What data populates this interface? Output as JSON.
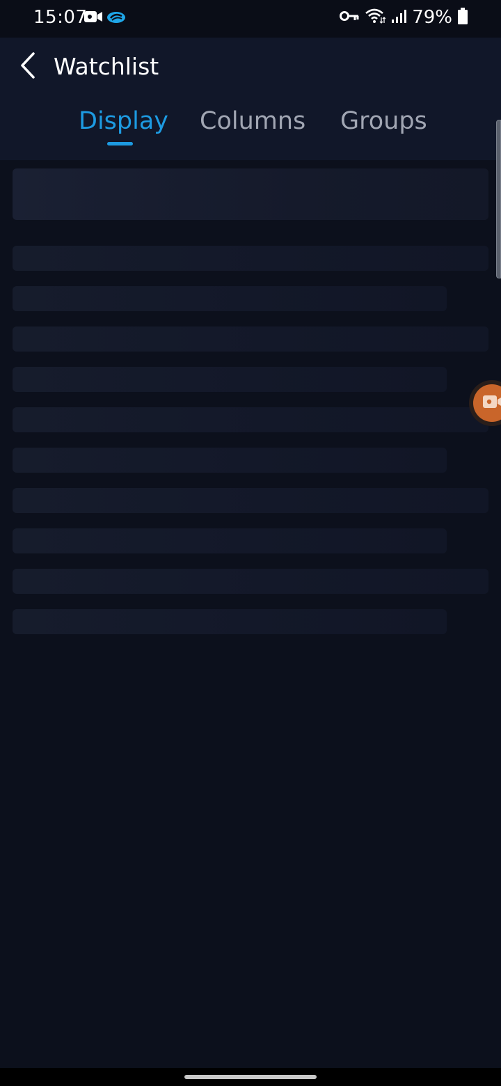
{
  "status_bar": {
    "time": "15:07",
    "battery": "79%",
    "icons": [
      "video-camera-icon",
      "cloud-app-icon",
      "vpn-key-icon",
      "wifi-icon",
      "signal-icon",
      "battery-icon"
    ]
  },
  "header": {
    "title": "Watchlist",
    "back_icon": "chevron-left-icon"
  },
  "tabs": [
    {
      "label": "Display",
      "active": true
    },
    {
      "label": "Columns",
      "active": false
    },
    {
      "label": "Groups",
      "active": false
    }
  ],
  "colors": {
    "accent": "#1d9be2",
    "background": "#0c101c",
    "header": "#111729",
    "inactive_tab": "#a1a6b3",
    "float_button": "#c9652a"
  },
  "content": {
    "state": "loading",
    "skeleton_rows": 10
  },
  "floating_button": {
    "icon": "video-camera-icon"
  }
}
